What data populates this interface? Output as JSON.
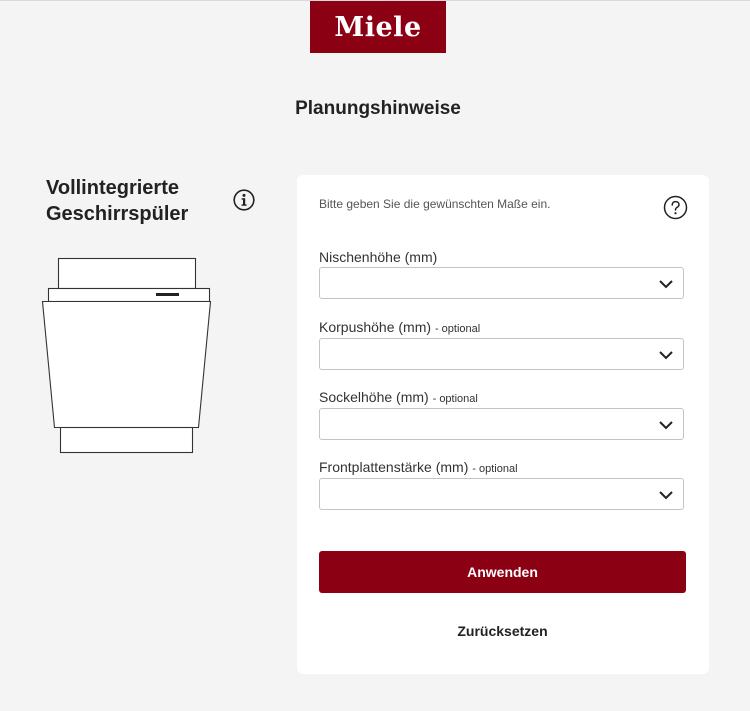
{
  "brand": {
    "logo_text": "Miele",
    "color": "#8c0014"
  },
  "page": {
    "title": "Planungshinweise"
  },
  "product": {
    "title_line1": "Vollintegrierte",
    "title_line2": "Geschirrspüler",
    "info_icon": "info-circle-icon"
  },
  "form": {
    "hint": "Bitte geben Sie die gewünschten Maße ein.",
    "help_icon": "question-circle-icon",
    "fields": [
      {
        "label": "Nischenhöhe (mm)",
        "optional": "",
        "value": ""
      },
      {
        "label": "Korpushöhe (mm)",
        "optional": "- optional",
        "value": ""
      },
      {
        "label": "Sockelhöhe (mm)",
        "optional": "- optional",
        "value": ""
      },
      {
        "label": "Frontplattenstärke (mm)",
        "optional": "- optional",
        "value": ""
      }
    ],
    "apply_label": "Anwenden",
    "reset_label": "Zurücksetzen"
  }
}
